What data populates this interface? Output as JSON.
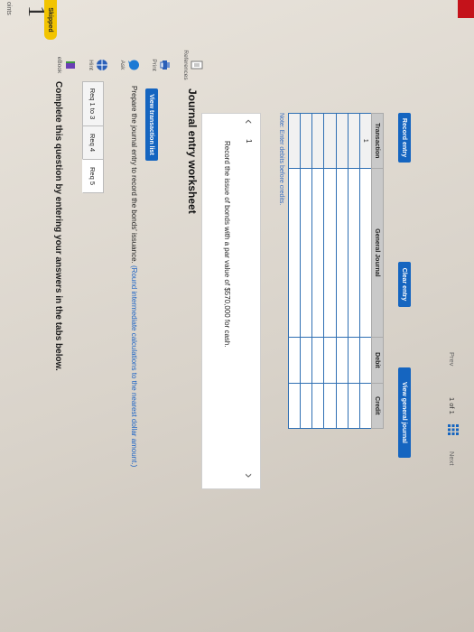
{
  "sidebar": {
    "question_number": "1",
    "points_label": "oints",
    "status": "Skipped"
  },
  "tools": {
    "ebook": "eBook",
    "hint": "Hint",
    "ask": "Ask",
    "print": "Print",
    "references": "References"
  },
  "header": {
    "title": "Complete this question by entering your answers in the tabs below."
  },
  "tabs": [
    {
      "label": "Req 1 to 3"
    },
    {
      "label": "Req 4"
    },
    {
      "label": "Req 5"
    }
  ],
  "instruction": {
    "main": "Prepare the journal entry to record the bonds' issuance.",
    "note": "(Round intermediate calculations to the nearest dollar amount.)"
  },
  "view_transaction_list": "View transaction list",
  "worksheet": {
    "title": "Journal entry worksheet",
    "page": "1",
    "description": "Record the issue of bonds with a par value of $570,000 for cash.",
    "note": "Note: Enter debits before credits.",
    "columns": [
      "Transaction",
      "General Journal",
      "Debit",
      "Credit"
    ],
    "rows": [
      [
        "1",
        "",
        "",
        ""
      ],
      [
        "",
        "",
        "",
        ""
      ],
      [
        "",
        "",
        "",
        ""
      ],
      [
        "",
        "",
        "",
        ""
      ],
      [
        "",
        "",
        "",
        ""
      ],
      [
        "",
        "",
        "",
        ""
      ],
      [
        "",
        "",
        "",
        ""
      ]
    ]
  },
  "buttons": {
    "record_entry": "Record entry",
    "clear_entry": "Clear entry",
    "view_general_journal": "View general journal"
  },
  "pager": {
    "prev": "Prev",
    "position": "1 of 1",
    "next": "Next"
  },
  "colors": {
    "accent": "#1565c0",
    "skipped": "#f2c400"
  }
}
